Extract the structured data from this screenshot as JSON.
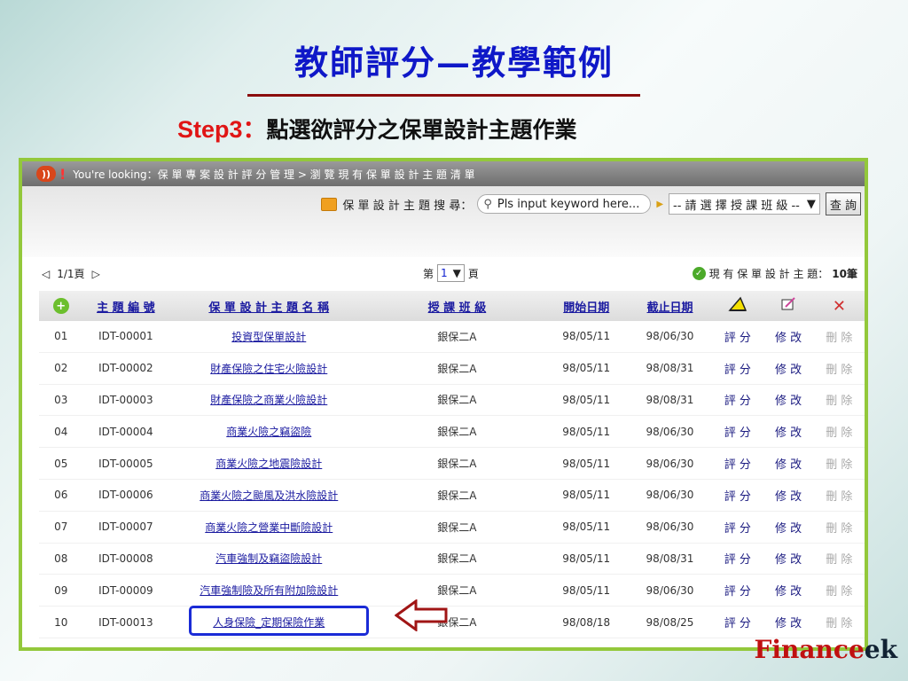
{
  "slide": {
    "title": "教師評分—教學範例",
    "step_label": "Step3",
    "step_colon": "：",
    "step_text": "點選欲評分之保單設計主題作業",
    "brand_a": "Finance",
    "brand_b": "ek"
  },
  "app": {
    "breadcrumb_prefix": "You're looking：",
    "breadcrumb": "保 單 專 案 設 計 評 分 管 理 > 瀏 覽 現 有 保 單 設 計 主 題 清 單",
    "search_label": "保 單 設 計 主 題 搜 尋：",
    "search_placeholder": "Pls input keyword here...",
    "class_select": "-- 請 選 擇 授 課 班 級 --",
    "query_button": "查 詢",
    "page_info": "1/1頁",
    "page_prefix": "第",
    "page_current": "1",
    "page_suffix": "頁",
    "total_label": "現 有 保 單 設 計 主 題：",
    "total_count": "10筆",
    "columns": [
      "主 題 編 號",
      "保 單 設 計 主 題 名 稱",
      "授 課 班 級",
      "開始日期",
      "截止日期"
    ],
    "action_grade": "評 分",
    "action_edit": "修 改",
    "action_delete": "刪 除",
    "rows": [
      {
        "no": "01",
        "id": "IDT-00001",
        "name": "投資型保單設計",
        "cls": "銀保二A",
        "start": "98/05/11",
        "end": "98/06/30"
      },
      {
        "no": "02",
        "id": "IDT-00002",
        "name": "財產保險之住宅火險設計",
        "cls": "銀保二A",
        "start": "98/05/11",
        "end": "98/08/31"
      },
      {
        "no": "03",
        "id": "IDT-00003",
        "name": "財產保險之商業火險設計",
        "cls": "銀保二A",
        "start": "98/05/11",
        "end": "98/08/31"
      },
      {
        "no": "04",
        "id": "IDT-00004",
        "name": "商業火險之竊盜險",
        "cls": "銀保二A",
        "start": "98/05/11",
        "end": "98/06/30"
      },
      {
        "no": "05",
        "id": "IDT-00005",
        "name": "商業火險之地震險設計",
        "cls": "銀保二A",
        "start": "98/05/11",
        "end": "98/06/30"
      },
      {
        "no": "06",
        "id": "IDT-00006",
        "name": "商業火險之颱風及洪水險設計",
        "cls": "銀保二A",
        "start": "98/05/11",
        "end": "98/06/30"
      },
      {
        "no": "07",
        "id": "IDT-00007",
        "name": "商業火險之營業中斷險設計",
        "cls": "銀保二A",
        "start": "98/05/11",
        "end": "98/06/30"
      },
      {
        "no": "08",
        "id": "IDT-00008",
        "name": "汽車強制及竊盜險設計",
        "cls": "銀保二A",
        "start": "98/05/11",
        "end": "98/08/31"
      },
      {
        "no": "09",
        "id": "IDT-00009",
        "name": "汽車強制險及所有附加險設計",
        "cls": "銀保二A",
        "start": "98/05/11",
        "end": "98/06/30"
      },
      {
        "no": "10",
        "id": "IDT-00013",
        "name": "人身保險_定期保險作業",
        "cls": "銀保二A",
        "start": "98/08/18",
        "end": "98/08/25"
      }
    ]
  }
}
